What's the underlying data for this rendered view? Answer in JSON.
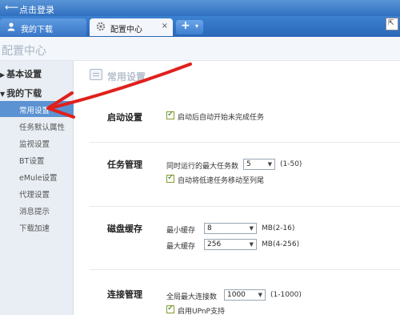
{
  "topbar": {
    "back_icon": "back-arrow-icon",
    "title": "点击登录"
  },
  "tabs": [
    {
      "label": "我的下载",
      "icon": "user-icon"
    },
    {
      "label": "配置中心",
      "icon": "gear-icon",
      "close": "×"
    }
  ],
  "newtab": {
    "plus": "+",
    "dropdown": "▾"
  },
  "window_button": "⇱",
  "config_header": {
    "title": "配置中心"
  },
  "sidebar": {
    "sections": [
      {
        "label": "基本设置",
        "arrow": "▶"
      },
      {
        "label": "我的下载",
        "arrow": "▼"
      }
    ],
    "items": [
      {
        "label": "常用设置",
        "active": true
      },
      {
        "label": "任务默认属性"
      },
      {
        "label": "监视设置"
      },
      {
        "label": "BT设置"
      },
      {
        "label": "eMule设置"
      },
      {
        "label": "代理设置"
      },
      {
        "label": "消息提示"
      },
      {
        "label": "下载加速"
      }
    ]
  },
  "content": {
    "header": "常用设置",
    "groups": {
      "startup": {
        "title": "启动设置",
        "auto_start": {
          "label": "启动后自动开始未完成任务",
          "checked": true
        }
      },
      "task": {
        "title": "任务管理",
        "max_running_label": "同时运行的最大任务数",
        "max_running_value": "5",
        "max_running_range": "(1-50)",
        "auto_move": {
          "label": "自动将低速任务移动至列尾",
          "checked": true
        }
      },
      "disk": {
        "title": "磁盘缓存",
        "min_label": "最小缓存",
        "min_value": "8",
        "min_range": "MB(2-16)",
        "max_label": "最大缓存",
        "max_value": "256",
        "max_range": "MB(4-256)"
      },
      "connection": {
        "title": "连接管理",
        "global_max_label": "全局最大连接数",
        "global_max_value": "1000",
        "global_max_range": "(1-1000)",
        "upnp": {
          "label": "启用UPnP支持",
          "checked": true
        }
      }
    }
  },
  "colors": {
    "accent": "#5b92d2",
    "annotation": "#e0201c",
    "checkbox_check": "#2e7d1d"
  }
}
